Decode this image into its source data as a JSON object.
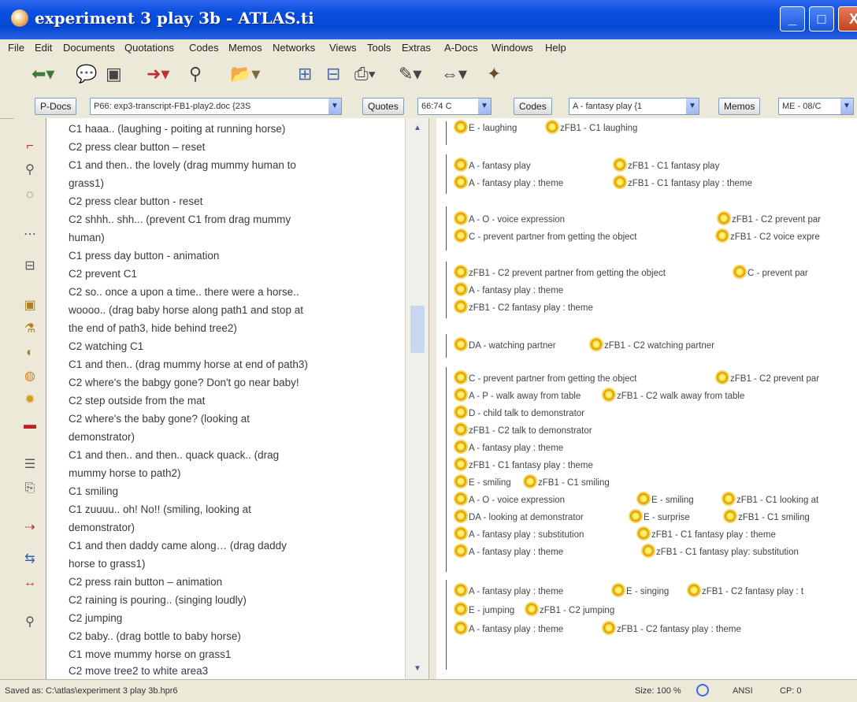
{
  "window": {
    "title": "experiment 3 play 3b - ATLAS.ti",
    "controls": {
      "minimize": "_",
      "maximize": "□",
      "close": "X"
    }
  },
  "menu": [
    "File",
    "Edit",
    "Documents",
    "Quotations",
    "Codes",
    "Memos",
    "Networks",
    "Views",
    "Tools",
    "Extras",
    "A-Docs",
    "Windows",
    "Help"
  ],
  "toolbar": {
    "icons": [
      "back-icon",
      "comment-icon",
      "save-icon",
      "import-icon",
      "binoculars-icon",
      "folder-icon",
      "query-icon",
      "filter-icon",
      "print-icon",
      "wrench-icon",
      "link-icon",
      "network-icon"
    ]
  },
  "managers": {
    "pdocs": {
      "label": "P-Docs",
      "value": "P66: exp3-transcript-FB1-play2.doc {23S"
    },
    "quotes": {
      "label": "Quotes",
      "value": "66:74 C"
    },
    "codes": {
      "label": "Codes",
      "value": "A - fantasy play {1"
    },
    "memos": {
      "label": "Memos",
      "value": "ME - 08/C"
    }
  },
  "document": {
    "lines": [
      "C1 haaa.. (laughing - poiting at running horse)",
      "C2 press clear button – reset",
      "C1 and then.. the lovely (drag mummy human to",
      "grass1)",
      "C2 press clear button  - reset",
      "C2 shhh.. shh... (prevent C1 from drag mummy",
      "human)",
      "C1 press day button - animation",
      "C2 prevent C1",
      "C2 so.. once a upon a time.. there were a horse..",
      "woooo.. (drag baby horse along path1 and stop at",
      "the end of path3, hide behind tree2)",
      "C2 watching C1",
      "C1 and then.. (drag mummy horse at end of path3)",
      "C2 where's the babgy gone? Don't go near baby!",
      "C2 step outside from the mat",
      "C2 where's the baby gone? (looking at",
      "demonstrator)",
      "C1 and then.. and then.. quack quack.. (drag",
      "mummy horse to path2)",
      "C1 smiling",
      "C1 zuuuu.. oh! No!! (smiling, looking at",
      "demonstrator)",
      "C1 and then daddy came along… (drag daddy",
      "horse to grass1)",
      "C2 press rain button – animation",
      "C2 raining is pouring.. (singing loudly)",
      "C2 jumping",
      "C2 baby.. (drag bottle to baby horse)",
      "C1 move mummy horse on grass1",
      "C2 move tree2 to white area3"
    ]
  },
  "margin": {
    "codes": [
      {
        "text": "E - laughing"
      },
      {
        "text": "zFB1 - C1 laughing"
      },
      {
        "text": "A - fantasy play"
      },
      {
        "text": "zFB1 - C1 fantasy play"
      },
      {
        "text": "A - fantasy play : theme"
      },
      {
        "text": "zFB1 - C1 fantasy play : theme"
      },
      {
        "text": "A - O - voice expression"
      },
      {
        "text": "zFB1 - C2 prevent par"
      },
      {
        "text": "C - prevent partner from getting the object"
      },
      {
        "text": "zFB1 - C2 voice expre"
      },
      {
        "text": "zFB1 - C2 prevent partner from getting the object"
      },
      {
        "text": "C - prevent par"
      },
      {
        "text": "A - fantasy play : theme"
      },
      {
        "text": "zFB1 - C2 fantasy play : theme"
      },
      {
        "text": "DA - watching partner"
      },
      {
        "text": "zFB1 - C2 watching partner"
      },
      {
        "text": "C - prevent partner from getting the object"
      },
      {
        "text": "zFB1 - C2 prevent par"
      },
      {
        "text": "A - P - walk away from table"
      },
      {
        "text": "zFB1 - C2 walk away from table"
      },
      {
        "text": "D - child talk to demonstrator"
      },
      {
        "text": "zFB1 - C2 talk to demonstrator"
      },
      {
        "text": "A - fantasy play : theme"
      },
      {
        "text": "zFB1 - C1 fantasy play : theme"
      },
      {
        "text": "E - smiling"
      },
      {
        "text": "zFB1 - C1 smiling"
      },
      {
        "text": "A - O - voice expression"
      },
      {
        "text": "E - smiling"
      },
      {
        "text": "zFB1 - C1 looking at"
      },
      {
        "text": "DA - looking at demonstrator"
      },
      {
        "text": "E - surprise"
      },
      {
        "text": "zFB1 - C1 smiling"
      },
      {
        "text": "A - fantasy play : substitution"
      },
      {
        "text": "zFB1 - C1 fantasy play : theme"
      },
      {
        "text": "A - fantasy play : theme"
      },
      {
        "text": "zFB1 - C1 fantasy play: substitution"
      },
      {
        "text": "A - fantasy play : theme"
      },
      {
        "text": "E - singing"
      },
      {
        "text": "zFB1 - C2 fantasy play : t"
      },
      {
        "text": "E - jumping"
      },
      {
        "text": "zFB1 - C2 jumping"
      },
      {
        "text": "A - fantasy play : theme"
      },
      {
        "text": "zFB1 - C2 fantasy play : theme"
      }
    ]
  },
  "status": {
    "saved": "Saved as: C:\\atlas\\experiment 3 play 3b.hpr6",
    "size": "Size: 100 %",
    "encoding": "ANSI",
    "codepage": "CP: 0"
  }
}
